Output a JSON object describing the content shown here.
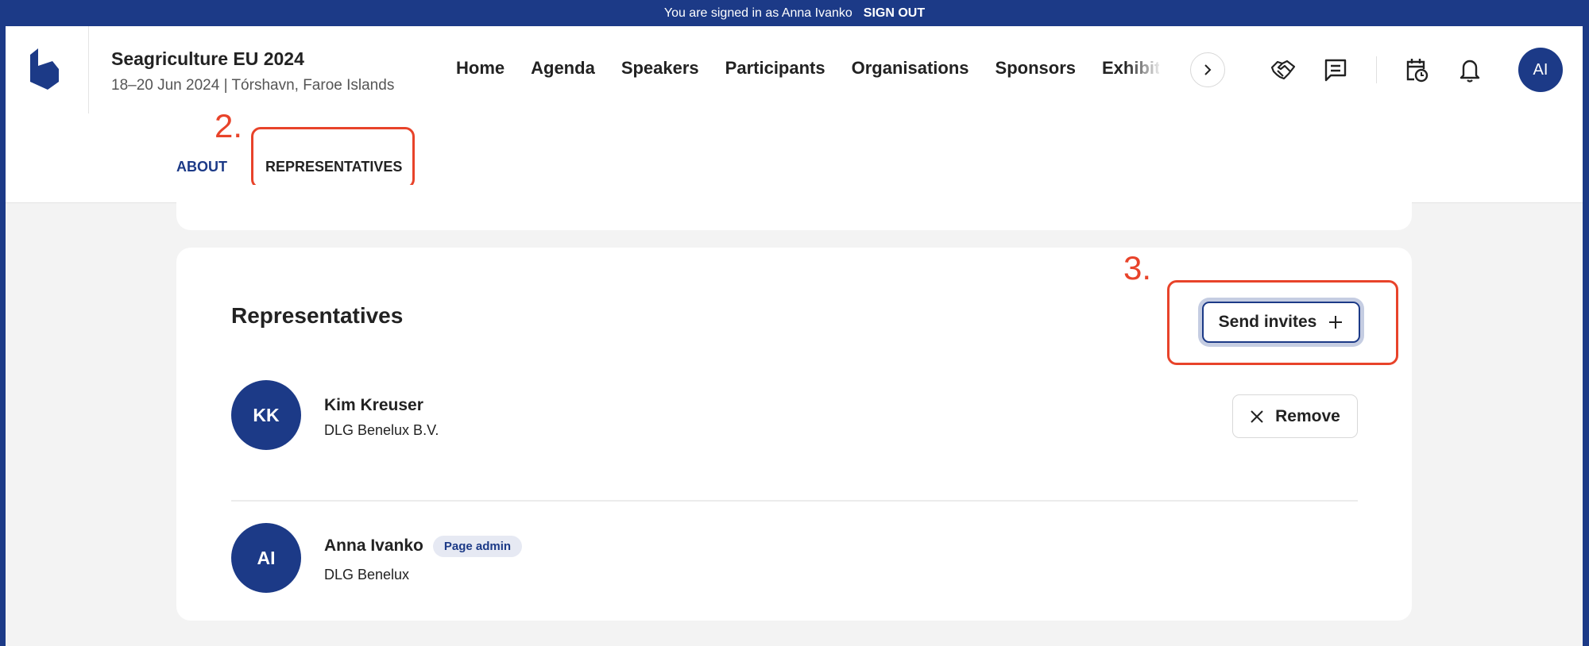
{
  "topbar": {
    "signed_in_text": "You are signed in as Anna Ivanko",
    "sign_out_label": "SIGN OUT"
  },
  "header": {
    "title": "Seagriculture EU 2024",
    "subtitle": "18–20 Jun 2024 | Tórshavn, Faroe Islands",
    "nav": [
      "Home",
      "Agenda",
      "Speakers",
      "Participants",
      "Organisations",
      "Sponsors",
      "Exhibit"
    ],
    "user_initials": "AI",
    "icons": [
      "handshake-icon",
      "chat-icon",
      "calendar-clock-icon",
      "bell-icon",
      "chevron-right-icon"
    ]
  },
  "tabs": [
    {
      "label": "ABOUT",
      "active": true
    },
    {
      "label": "REPRESENTATIVES",
      "active": false
    }
  ],
  "annotations": {
    "step2": "2.",
    "step3": "3.",
    "color": "#e8432a"
  },
  "representatives": {
    "heading": "Representatives",
    "send_invites_label": "Send invites",
    "remove_label": "Remove",
    "items": [
      {
        "initials": "KK",
        "name": "Kim Kreuser",
        "org": "DLG Benelux B.V.",
        "badge": null
      },
      {
        "initials": "AI",
        "name": "Anna Ivanko",
        "org": "DLG Benelux",
        "badge": "Page admin"
      }
    ]
  },
  "colors": {
    "brand": "#1c3a87",
    "background": "#f3f3f3"
  }
}
